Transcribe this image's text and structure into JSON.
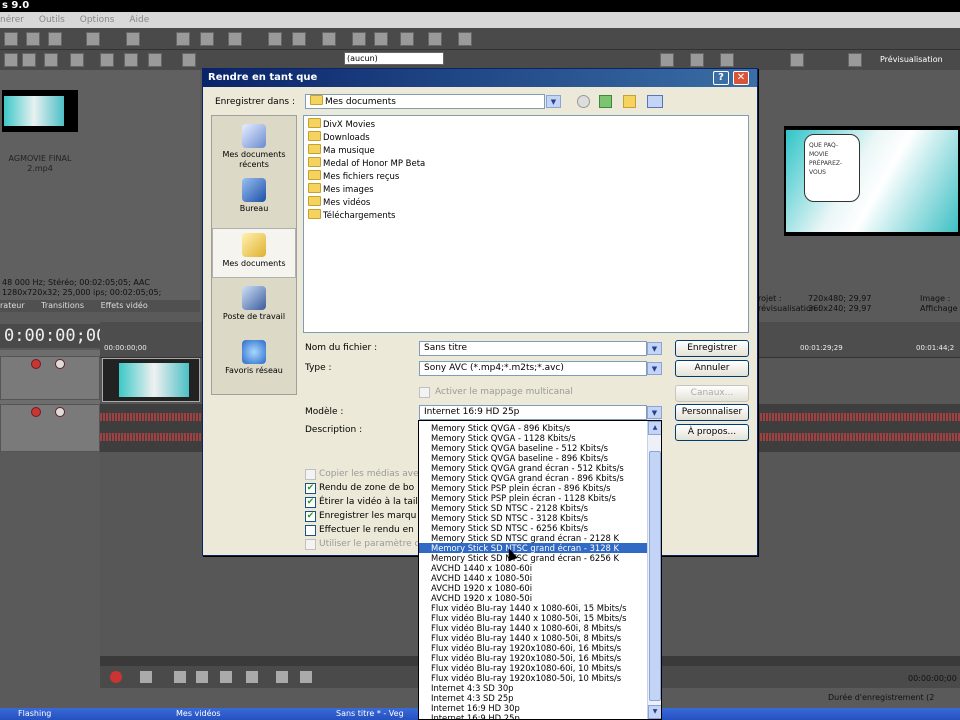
{
  "app": {
    "title_fragment": "s 9.0",
    "menu": [
      "nérer",
      "Outils",
      "Options",
      "Aide"
    ],
    "combo_value": "(aucun)",
    "preview_label": "Prévisualisation",
    "media_name_line1": "AGMOVIE FINAL",
    "media_name_line2": "2.mp4",
    "media_info_line1": "48 000 Hz; Stéréo; 00:02:05;05; AAC",
    "media_info_line2": "1280x720x32; 25,000 ips; 00:02:05;05;",
    "tabs": [
      "rateur",
      "Transitions",
      "Effets vidéo"
    ],
    "bubble_text": "QUE PAQ-MOVIE PRÉPAREZ- VOUS",
    "project_label": "rojet :",
    "project_value": "720x480; 29,97",
    "preview_label2": "révisualisation :",
    "preview_value": "360x240; 29,97",
    "image_label": "Image :",
    "display_label": "Affichage",
    "timecode": "0:00:00;00",
    "ruler_marks": [
      "00:00:00;00",
      "00:01:29;29",
      "00:01:44;2"
    ],
    "time_right": "00:00:00;00",
    "duree_label": "Durée d'enregistrement (2",
    "taskbar": [
      "Flashing",
      "Mes vidéos",
      "Sans titre * - Veg"
    ]
  },
  "dialog": {
    "title": "Rendre en tant que",
    "help_label": "?",
    "close_label": "✕",
    "save_in_label": "Enregistrer dans :",
    "save_in_value": "Mes documents",
    "places": [
      {
        "label": "Mes documents récents",
        "icon": "recent-icon",
        "selected": false
      },
      {
        "label": "Bureau",
        "icon": "desktop-icon",
        "selected": false
      },
      {
        "label": "Mes documents",
        "icon": "documents-icon",
        "selected": true
      },
      {
        "label": "Poste de travail",
        "icon": "computer-icon",
        "selected": false
      },
      {
        "label": "Favoris réseau",
        "icon": "network-icon",
        "selected": false
      }
    ],
    "files": [
      "DivX Movies",
      "Downloads",
      "Ma musique",
      "Medal of Honor MP Beta",
      "Mes fichiers reçus",
      "Mes images",
      "Mes vidéos",
      "Téléchargements"
    ],
    "filename_label": "Nom du fichier :",
    "filename_value": "Sans titre",
    "type_label": "Type :",
    "type_value": "Sony AVC (*.mp4;*.m2ts;*.avc)",
    "multichannel_label": "Activer le mappage multicanal",
    "template_label": "Modèle :",
    "template_value": "Internet 16:9 HD 25p",
    "description_label": "Description :",
    "buttons": {
      "save": "Enregistrer",
      "cancel": "Annuler",
      "channels": "Canaux...",
      "customize": "Personnaliser",
      "about": "À propos..."
    },
    "options": [
      {
        "label": "Copier les médias ave",
        "checked": false,
        "disabled": true
      },
      {
        "label": "Rendu de zone de bo",
        "checked": true,
        "disabled": false
      },
      {
        "label": "Étirer la vidéo à la tail",
        "checked": true,
        "disabled": false
      },
      {
        "label": "Enregistrer les marqu",
        "checked": true,
        "disabled": false
      },
      {
        "label": "Effectuer le rendu en",
        "checked": false,
        "disabled": false
      },
      {
        "label": "Utiliser le paramètre c",
        "checked": false,
        "disabled": true
      }
    ],
    "template_options": [
      "Memory Stick QVGA - 896 Kbits/s",
      "Memory Stick QVGA - 1128 Kbits/s",
      "Memory Stick QVGA baseline - 512 Kbits/s",
      "Memory Stick QVGA baseline - 896 Kbits/s",
      "Memory Stick QVGA grand écran - 512 Kbits/s",
      "Memory Stick QVGA grand écran - 896 Kbits/s",
      "Memory Stick PSP plein écran - 896 Kbits/s",
      "Memory Stick PSP plein écran - 1128 Kbits/s",
      "Memory Stick SD NTSC - 2128 Kbits/s",
      "Memory Stick SD NTSC - 3128 Kbits/s",
      "Memory Stick SD NTSC - 6256 Kbits/s",
      "Memory Stick SD NTSC grand écran - 2128 K",
      "Memory Stick SD NTSC grand écran - 3128 K",
      "Memory Stick SD NTSC grand écran - 6256 K",
      "AVCHD 1440 x 1080-60i",
      "AVCHD 1440 x 1080-50i",
      "AVCHD 1920 x 1080-60i",
      "AVCHD 1920 x 1080-50i",
      "Flux vidéo Blu-ray 1440 x 1080-60i, 15 Mbits/s",
      "Flux vidéo Blu-ray 1440 x 1080-50i, 15 Mbits/s",
      "Flux vidéo Blu-ray 1440 x 1080-60i, 8 Mbits/s",
      "Flux vidéo Blu-ray 1440 x 1080-50i, 8 Mbits/s",
      "Flux vidéo Blu-ray 1920x1080-60i, 16 Mbits/s",
      "Flux vidéo Blu-ray 1920x1080-50i, 16 Mbits/s",
      "Flux vidéo Blu-ray 1920x1080-60i, 10 Mbits/s",
      "Flux vidéo Blu-ray 1920x1080-50i, 10 Mbits/s",
      "Internet 4:3 SD 30p",
      "Internet 4:3 SD 25p",
      "Internet 16:9 HD 30p",
      "Internet 16:9 HD 25p"
    ],
    "highlighted_option": "Memory Stick SD NTSC grand écran - 3128 K",
    "accent_color": "#316ac5",
    "title_color": "#0a246a"
  }
}
